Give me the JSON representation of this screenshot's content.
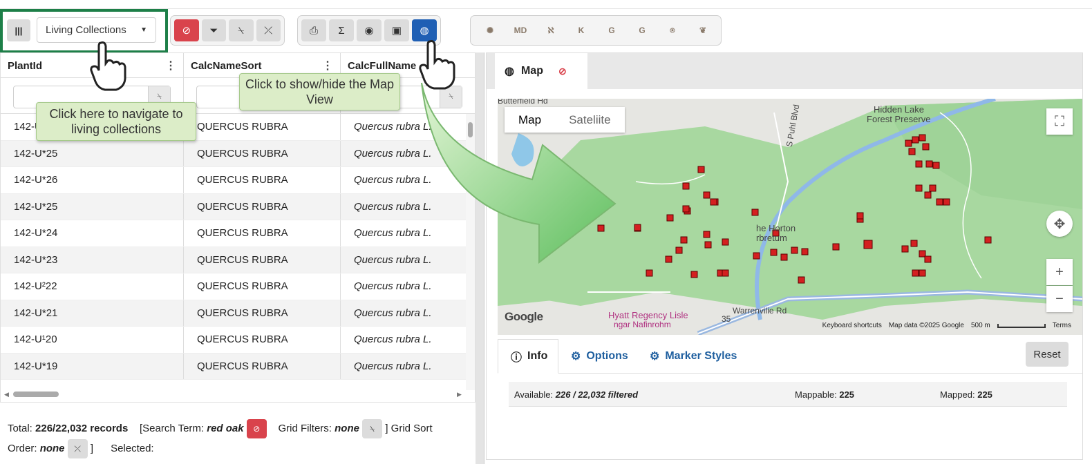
{
  "toolbar": {
    "columns_icon": "columns-icon",
    "collection_select": "Living Collections",
    "filter_buttons": [
      {
        "name": "clear-search-button",
        "icon": "⊘",
        "style": "red"
      },
      {
        "name": "filter-button",
        "icon": "⏷",
        "style": "grey"
      },
      {
        "name": "clear-grid-filters-button",
        "icon": "⍀",
        "style": "grey"
      },
      {
        "name": "clear-sort-button",
        "icon": "⤫",
        "style": "grey"
      }
    ],
    "view_buttons": [
      {
        "name": "export-button",
        "icon": "⎙",
        "style": "grey"
      },
      {
        "name": "summary-button",
        "icon": "Σ",
        "style": "grey"
      },
      {
        "name": "visibility-button",
        "icon": "◉",
        "style": "grey"
      },
      {
        "name": "image-view-button",
        "icon": "▣",
        "style": "grey"
      },
      {
        "name": "map-view-button",
        "icon": "◍",
        "style": "blue"
      }
    ],
    "app_buttons": [
      "✺",
      "MD",
      "ℵ",
      "K",
      "G",
      "G",
      "⍟",
      "❦"
    ]
  },
  "grid": {
    "columns": [
      "PlantId",
      "CalcNameSort",
      "CalcFullName"
    ],
    "rows": [
      [
        "142-U*27",
        "QUERCUS RUBRA",
        "Quercus rubra L."
      ],
      [
        "142-U*25",
        "QUERCUS RUBRA",
        "Quercus rubra L."
      ],
      [
        "142-U*26",
        "QUERCUS RUBRA",
        "Quercus rubra L."
      ],
      [
        "142-U*25",
        "QUERCUS RUBRA",
        "Quercus rubra L."
      ],
      [
        "142-U*24",
        "QUERCUS RUBRA",
        "Quercus rubra L."
      ],
      [
        "142-U*23",
        "QUERCUS RUBRA",
        "Quercus rubra L."
      ],
      [
        "142-U²22",
        "QUERCUS RUBRA",
        "Quercus rubra L."
      ],
      [
        "142-U*21",
        "QUERCUS RUBRA",
        "Quercus rubra L."
      ],
      [
        "142-U¹20",
        "QUERCUS RUBRA",
        "Quercus rubra L."
      ],
      [
        "142-U*19",
        "QUERCUS RUBRA",
        "Quercus rubra L."
      ]
    ]
  },
  "footer": {
    "total_label": "Total:",
    "total_value": "226/22,032 records",
    "search_label": "[Search Term:",
    "search_value": "red oak",
    "filters_label": "Grid Filters:",
    "filters_value": "none",
    "sort_label": "] Grid Sort",
    "order_label": "Order:",
    "order_value": "none",
    "close_bracket": "]",
    "selected_label": "Selected:"
  },
  "map_panel": {
    "tab_label": "Map",
    "map_type_map": "Map",
    "map_type_satellite": "Sateliite",
    "labels": {
      "road1": "Butterfield Hd",
      "preserve1": "Hidden Lake",
      "preserve2": "Forest Preserve",
      "road2": "S Puhl Blvd",
      "arboretum1": "he Horton",
      "arboretum2": "rbretum",
      "hotel1": "Hyatt Regency Lisle",
      "hotel2": "ngar Nafinrohm",
      "road3": "Warrenvilie Rd",
      "route": "35"
    },
    "google": "Google",
    "attrib_shortcuts": "Keyboard shortcuts",
    "attrib_data": "Map data ©2025 Google",
    "attrib_scale": "500 m",
    "attrib_terms": "Terms",
    "info_tab": "Info",
    "options_tab": "Options",
    "marker_styles_tab": "Marker Styles",
    "reset": "Reset",
    "available_label": "Available:",
    "available_value": "226 / 22,032 filtered",
    "mappable_label": "Mappable:",
    "mappable_value": "225",
    "mapped_label": "Mapped:",
    "mapped_value": "225"
  },
  "callouts": {
    "navigate": "Click here to navigate to living collections",
    "map_view": "Click to show/hide the Map View"
  },
  "colors": {
    "accent_green": "#1d7f48",
    "danger_red": "#d9434c",
    "primary_blue": "#1f5fb4",
    "map_green": "#a8d8a0",
    "marker_red": "#d42020"
  }
}
